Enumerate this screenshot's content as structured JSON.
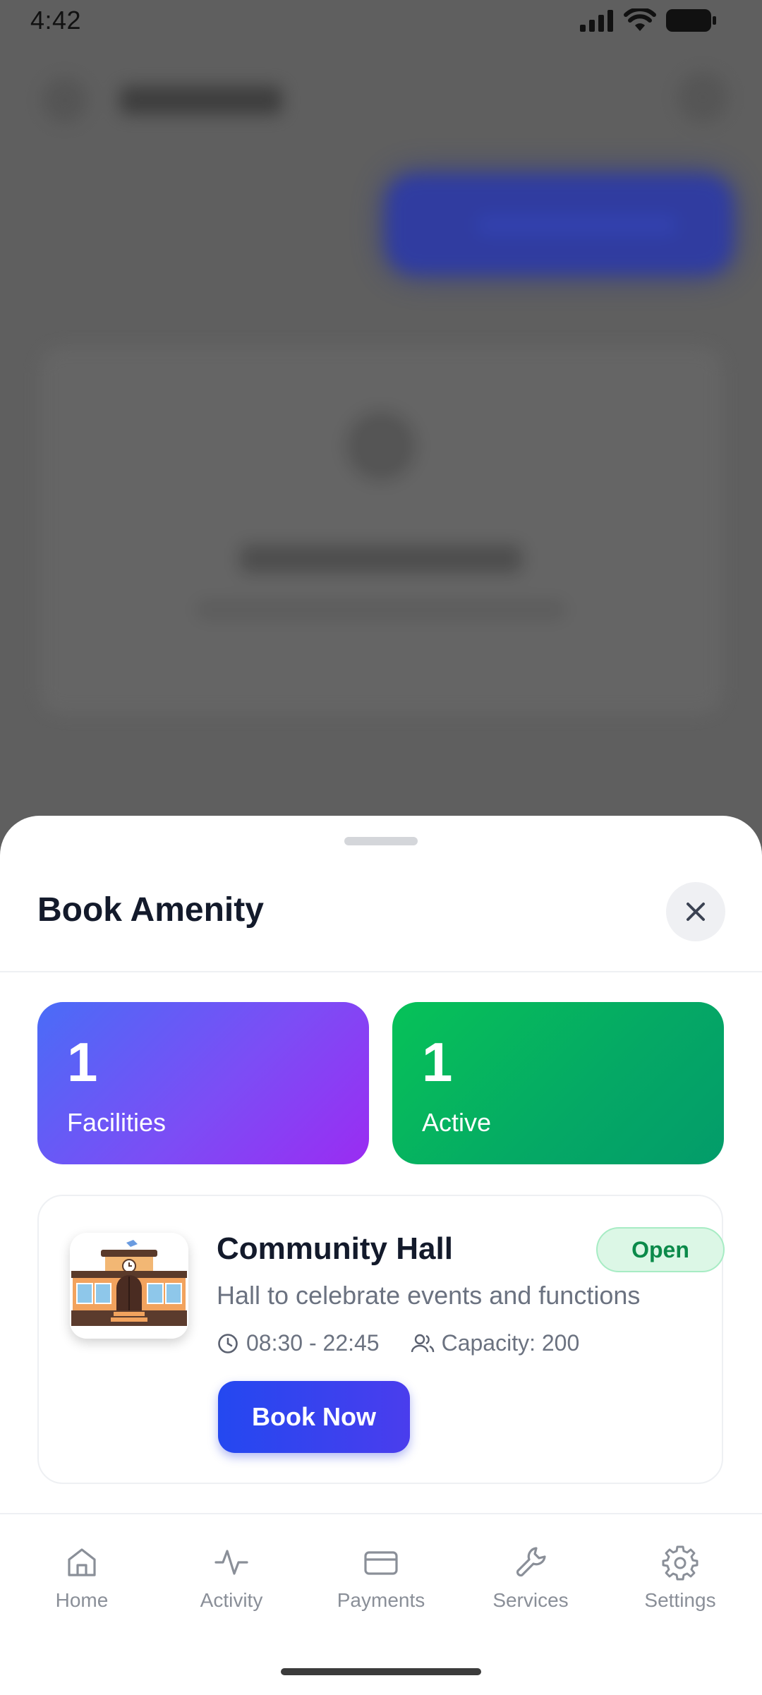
{
  "status_bar": {
    "time": "4:42"
  },
  "sheet": {
    "title": "Book Amenity",
    "stats": [
      {
        "value": "1",
        "label": "Facilities",
        "accent": "#7c4df5"
      },
      {
        "value": "1",
        "label": "Active",
        "accent": "#05a865"
      }
    ],
    "amenity": {
      "name": "Community Hall",
      "status": "Open",
      "description": "Hall to celebrate events and functions",
      "hours": "08:30 - 22:45",
      "capacity": "Capacity: 200",
      "book_label": "Book Now"
    }
  },
  "nav": {
    "items": [
      {
        "label": "Home",
        "icon": "home-icon"
      },
      {
        "label": "Activity",
        "icon": "activity-icon"
      },
      {
        "label": "Payments",
        "icon": "credit-card-icon"
      },
      {
        "label": "Services",
        "icon": "wrench-icon"
      },
      {
        "label": "Settings",
        "icon": "gear-icon"
      }
    ]
  },
  "colors": {
    "primary": "#2448f0",
    "open_badge": "#0b8a4a",
    "title": "#131a2b"
  }
}
